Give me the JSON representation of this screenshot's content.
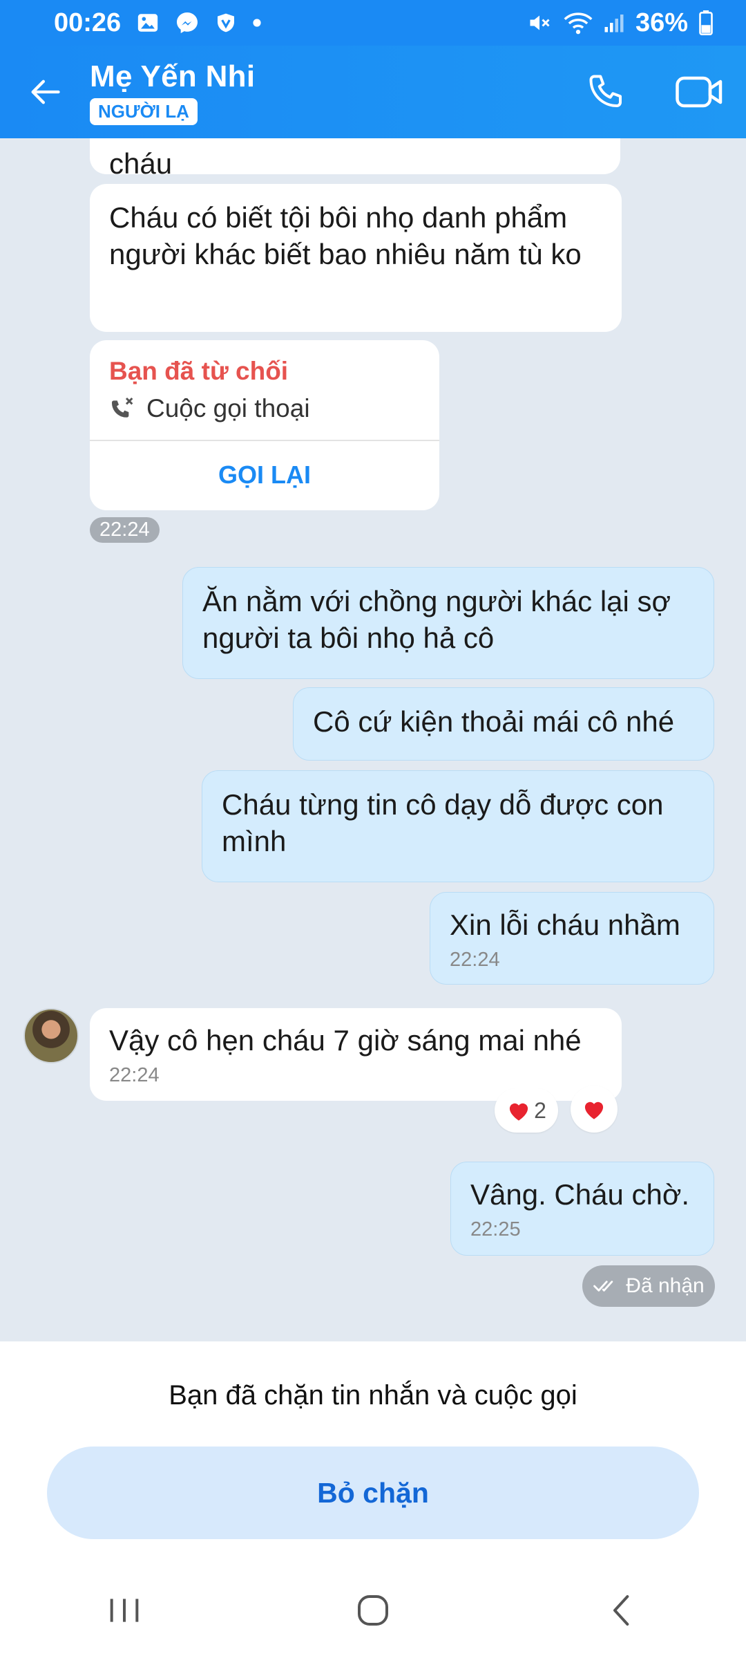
{
  "status_bar": {
    "time": "00:26",
    "battery": "36%"
  },
  "header": {
    "contact_name": "Mẹ Yến Nhi",
    "badge": "NGƯỜI LẠ"
  },
  "messages": {
    "m0": {
      "text": "cháu"
    },
    "m1": {
      "text": "Cháu có biết tội bôi nhọ danh phẩm người khác biết bao nhiêu năm tù ko"
    },
    "call": {
      "status": "Bạn đã từ chối",
      "type": "Cuộc gọi thoại",
      "action": "GỌI LẠI",
      "time": "22:24"
    },
    "m2": {
      "text": "Ăn nằm với chồng người khác lại sợ người ta bôi nhọ hả cô"
    },
    "m3": {
      "text": "Cô cứ kiện thoải mái cô nhé"
    },
    "m4": {
      "text": "Cháu từng tin cô dạy dỗ được con mình"
    },
    "m5": {
      "text": "Xin lỗi cháu nhầm",
      "time": "22:24"
    },
    "m6": {
      "text": "Vậy cô hẹn cháu 7 giờ sáng mai nhé",
      "time": "22:24"
    },
    "reactions": {
      "heart_count": "2"
    },
    "m7": {
      "text": "Vâng. Cháu chờ.",
      "time": "22:25"
    },
    "seen": "Đã nhận"
  },
  "blocked": {
    "text": "Bạn đã chặn tin nhắn và cuộc gọi",
    "button": "Bỏ chặn"
  },
  "colors": {
    "accent": "#1a8af4",
    "outgoing_bubble": "#d4ecfd",
    "declined": "#e6534f"
  }
}
